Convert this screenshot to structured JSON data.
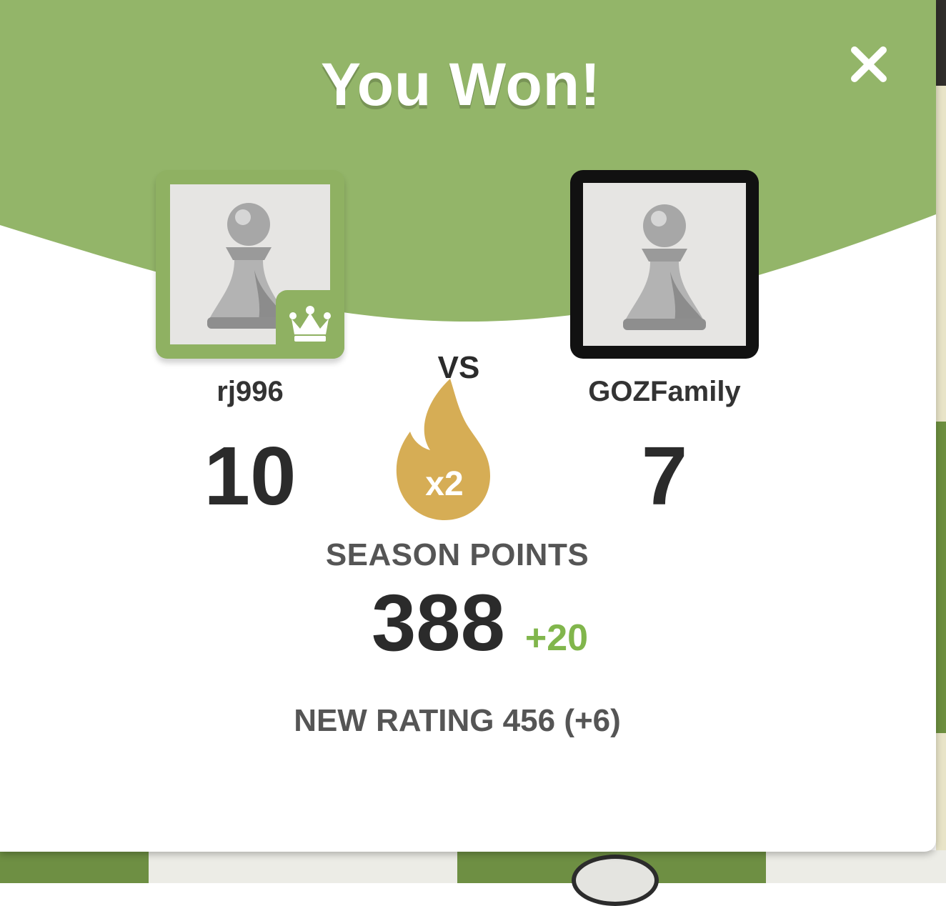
{
  "modal": {
    "title": "You Won!",
    "close_icon": "close-icon",
    "header_color": "#93b569"
  },
  "players": {
    "left": {
      "username": "rj996",
      "score": "10",
      "avatar_icon": "pawn-icon",
      "badge_icon": "crown-icon",
      "frame_color": "#8fb162"
    },
    "right": {
      "username": "GOZFamily",
      "score": "7",
      "avatar_icon": "pawn-icon",
      "frame_color": "#111111"
    }
  },
  "versus": {
    "label": "VS",
    "multiplier_icon": "flame-icon",
    "multiplier": "x2",
    "multiplier_color": "#d6ad55"
  },
  "season": {
    "label": "SEASON POINTS",
    "points": "388",
    "delta": "+20",
    "delta_color": "#81b64c"
  },
  "rating": {
    "text": "NEW RATING 456 (+6)"
  }
}
